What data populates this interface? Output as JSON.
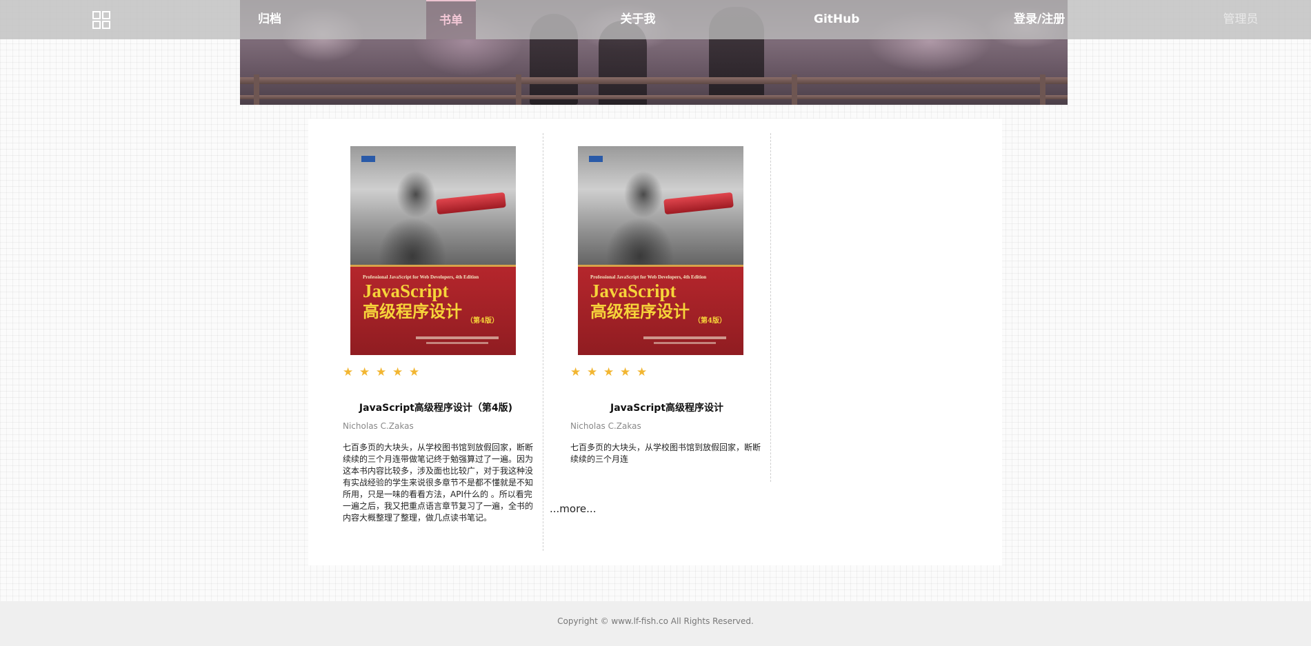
{
  "nav": {
    "menu_icon": "grid-icon",
    "items": {
      "archive": "归档",
      "books": "书单",
      "about": "关于我",
      "github": "GitHub",
      "login": "登录/注册",
      "admin": "管理员"
    },
    "active": "books"
  },
  "books": [
    {
      "title": "JavaScript高级程序设计（第4版)",
      "author": "Nicholas C.Zakas",
      "rating": 5,
      "description": "七百多页的大块头，从学校图书馆到放假回家，断断续续的三个月连带做笔记终于勉强算过了一遍。因为这本书内容比较多，涉及面也比较广，对于我这种没有实战经验的学生来说很多章节不是都不懂就是不知所用，只是一味的看看方法，API什么的 。所以看完一遍之后，我又把重点语言章节复习了一遍，全书的内容大概整理了整理，做几点读书笔记。",
      "cover": {
        "subtitle": "Professional JavaScript for Web Developers, 4th Edition",
        "title_en": "JavaScript",
        "title_cn": "高级程序设计",
        "edition": "（第4版）"
      }
    },
    {
      "title": "JavaScript高级程序设计",
      "author": "Nicholas C.Zakas",
      "rating": 5,
      "description": "七百多页的大块头，从学校图书馆到放假回家，断断续续的三个月连",
      "cover": {
        "subtitle": "Professional JavaScript for Web Developers, 4th Edition",
        "title_en": "JavaScript",
        "title_cn": "高级程序设计",
        "edition": "（第4版）"
      }
    }
  ],
  "more_label": "...more...",
  "footer": {
    "copyright": "Copyright © www.lf-fish.co All Rights Reserved."
  },
  "colors": {
    "accent_pink": "#f2c7d6",
    "star": "#f2b632",
    "cover_red": "#a02227",
    "cover_title": "#f6d43a"
  }
}
